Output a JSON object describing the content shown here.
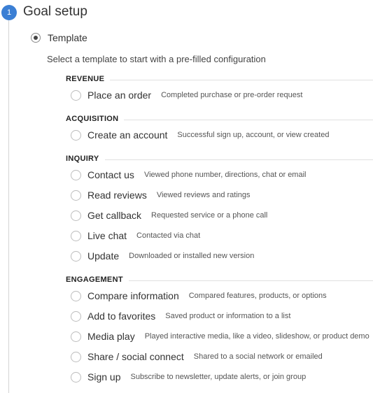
{
  "step": {
    "number": "1",
    "title": "Goal setup"
  },
  "template_option": {
    "label": "Template",
    "selected": true
  },
  "intro": "Select a template to start with a pre-filled configuration",
  "categories": [
    {
      "title": "REVENUE",
      "options": [
        {
          "label": "Place an order",
          "description": "Completed purchase or pre-order request"
        }
      ]
    },
    {
      "title": "ACQUISITION",
      "options": [
        {
          "label": "Create an account",
          "description": "Successful sign up, account, or view created"
        }
      ]
    },
    {
      "title": "INQUIRY",
      "options": [
        {
          "label": "Contact us",
          "description": "Viewed phone number, directions, chat or email"
        },
        {
          "label": "Read reviews",
          "description": "Viewed reviews and ratings"
        },
        {
          "label": "Get callback",
          "description": "Requested service or a phone call"
        },
        {
          "label": "Live chat",
          "description": "Contacted via chat"
        },
        {
          "label": "Update",
          "description": "Downloaded or installed new version"
        }
      ]
    },
    {
      "title": "ENGAGEMENT",
      "options": [
        {
          "label": "Compare information",
          "description": "Compared features, products, or options"
        },
        {
          "label": "Add to favorites",
          "description": "Saved product or information to a list"
        },
        {
          "label": "Media play",
          "description": "Played interactive media, like a video, slideshow, or product demo"
        },
        {
          "label": "Share / social connect",
          "description": "Shared to a social network or emailed"
        },
        {
          "label": "Sign up",
          "description": "Subscribe to newsletter, update alerts, or join group"
        }
      ]
    }
  ],
  "colors": {
    "accent": "#3b7fd4",
    "text": "#333333",
    "muted": "#555555",
    "rule": "#e0e0e0"
  }
}
